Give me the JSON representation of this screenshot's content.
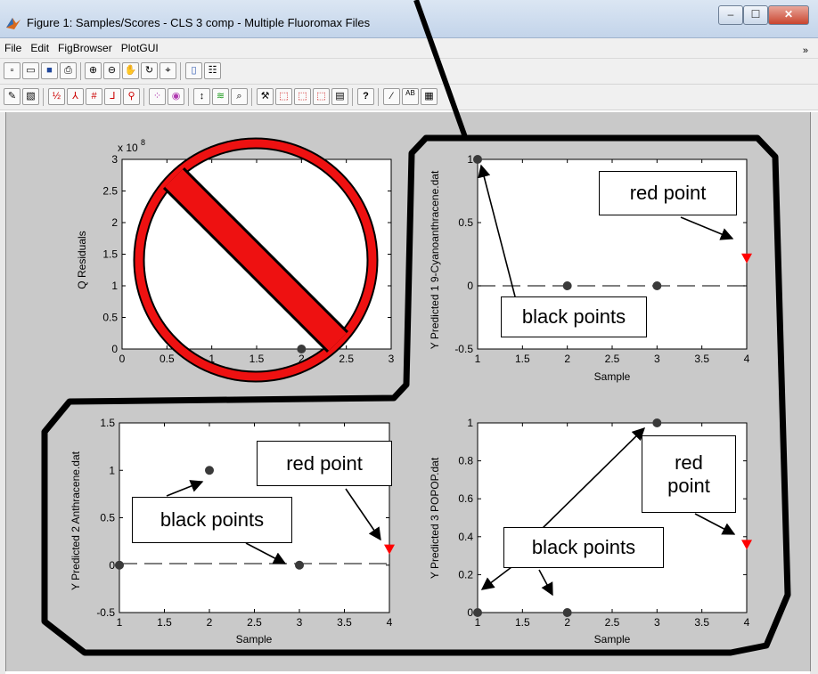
{
  "window": {
    "title": "Figure 1: Samples/Scores - CLS 3 comp - Multiple Fluoromax Files",
    "controls": {
      "minimize": "–",
      "maximize": "☐",
      "close": "✕"
    }
  },
  "menu": {
    "items": [
      "File",
      "Edit",
      "FigBrowser",
      "PlotGUI"
    ],
    "overflow": "»"
  },
  "toolbar1": {
    "icons": [
      "new-figure-icon",
      "open-folder-icon",
      "save-icon",
      "print-icon",
      "zoom-in-icon",
      "zoom-out-icon",
      "pan-hand-icon",
      "rotate-3d-icon",
      "data-cursor-icon",
      "colorbar-icon",
      "legend-icon"
    ]
  },
  "toolbar2": {
    "icons": [
      "edit-plot-icon",
      "plot-tools-icon",
      "label-numbers-icon",
      "label-classes-icon",
      "label-values-icon",
      "label-select-icon",
      "pin-icon",
      "scatter-matrix-icon",
      "classes-icon",
      "vertical-arrows-icon",
      "line-plot-icon",
      "zoom-plot-icon",
      "tools-icon",
      "select-points-icon",
      "deselect-points-icon",
      "toggle-points-icon",
      "hide-icon",
      "help-icon",
      "line-style-icon",
      "ab-table-icon",
      "spreadsheet-icon"
    ]
  },
  "plots": {
    "q_residuals": {
      "ylabel": "Q Residuals",
      "exponent": "x 10",
      "exponent_power": "8",
      "xticks": [
        "0",
        "0.5",
        "1",
        "1.5",
        "2",
        "2.5",
        "3"
      ],
      "yticks": [
        "0",
        "0.5",
        "1",
        "1.5",
        "2",
        "2.5",
        "3"
      ]
    },
    "y1": {
      "ylabel": "Y Predicted 1 9-Cyanoanthracene.dat",
      "xlabel": "Sample",
      "xticks": [
        "1",
        "1.5",
        "2",
        "2.5",
        "3",
        "3.5",
        "4"
      ],
      "yticks": [
        "-0.5",
        "0",
        "0.5",
        "1"
      ]
    },
    "y2": {
      "ylabel": "Y Predicted 2 Anthracene.dat",
      "xlabel": "Sample",
      "xticks": [
        "1",
        "1.5",
        "2",
        "2.5",
        "3",
        "3.5",
        "4"
      ],
      "yticks": [
        "-0.5",
        "0",
        "0.5",
        "1",
        "1.5"
      ]
    },
    "y3": {
      "ylabel": "Y Predicted 3 POPOP.dat",
      "xlabel": "Sample",
      "xticks": [
        "1",
        "1.5",
        "2",
        "2.5",
        "3",
        "3.5",
        "4"
      ],
      "yticks": [
        "0",
        "0.2",
        "0.4",
        "0.6",
        "0.8",
        "1"
      ]
    }
  },
  "chart_data": [
    {
      "type": "scatter",
      "ylabel": "Q Residuals",
      "xlim": [
        0,
        3
      ],
      "ylim": [
        0,
        3
      ],
      "y_multiplier": "x 10^8",
      "points": [
        {
          "x": 2,
          "y": 0,
          "color": "#3a3a3a"
        }
      ]
    },
    {
      "type": "scatter",
      "xlabel": "Sample",
      "ylabel": "Y Predicted 1 9-Cyanoanthracene.dat",
      "xlim": [
        1,
        4
      ],
      "ylim": [
        -0.5,
        1
      ],
      "points": [
        {
          "x": 1,
          "y": 1,
          "color": "#3a3a3a"
        },
        {
          "x": 2,
          "y": 0,
          "color": "#3a3a3a"
        },
        {
          "x": 3,
          "y": 0,
          "color": "#3a3a3a"
        },
        {
          "x": 4,
          "y": 0.22,
          "color": "#ff0000",
          "marker": "triangle-down"
        }
      ],
      "reference_line": 0
    },
    {
      "type": "scatter",
      "xlabel": "Sample",
      "ylabel": "Y Predicted 2 Anthracene.dat",
      "xlim": [
        1,
        4
      ],
      "ylim": [
        -0.5,
        1.5
      ],
      "points": [
        {
          "x": 1,
          "y": 0,
          "color": "#3a3a3a"
        },
        {
          "x": 2,
          "y": 1,
          "color": "#3a3a3a"
        },
        {
          "x": 3,
          "y": 0,
          "color": "#3a3a3a"
        },
        {
          "x": 4,
          "y": 0.17,
          "color": "#ff0000",
          "marker": "triangle-down"
        }
      ],
      "reference_line": 0
    },
    {
      "type": "scatter",
      "xlabel": "Sample",
      "ylabel": "Y Predicted 3 POPOP.dat",
      "xlim": [
        1,
        4
      ],
      "ylim": [
        0,
        1
      ],
      "points": [
        {
          "x": 1,
          "y": 0,
          "color": "#3a3a3a"
        },
        {
          "x": 2,
          "y": 0,
          "color": "#3a3a3a"
        },
        {
          "x": 3,
          "y": 1,
          "color": "#3a3a3a"
        },
        {
          "x": 4,
          "y": 0.36,
          "color": "#ff0000",
          "marker": "triangle-down"
        }
      ]
    }
  ],
  "annotations": {
    "callout_red_1": "red point",
    "callout_black_1": "black points",
    "callout_red_2": "red point",
    "callout_black_2": "black points",
    "callout_red_3": "red\npoint",
    "callout_black_3": "black points",
    "prohibition_sign": "no-symbol-icon"
  }
}
